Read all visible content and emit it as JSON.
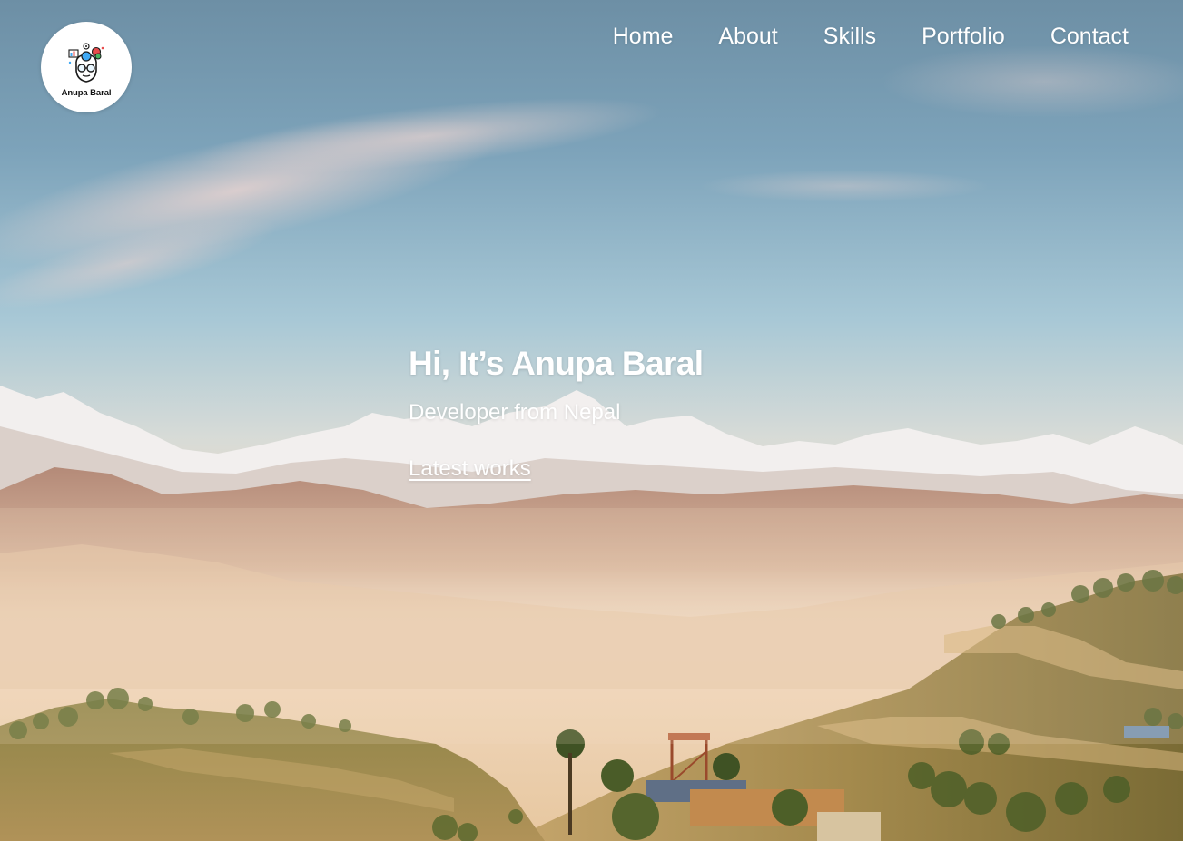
{
  "site": {
    "logo": {
      "text": "Anupa Baral",
      "icon": "avatar-head-icon"
    }
  },
  "nav": {
    "items": [
      {
        "label": "Home"
      },
      {
        "label": "About"
      },
      {
        "label": "Skills"
      },
      {
        "label": "Portfolio"
      },
      {
        "label": "Contact"
      }
    ]
  },
  "hero": {
    "title": "Hi, It’s Anupa Baral",
    "subtitle": "Developer from Nepal",
    "cta_label": "Latest works",
    "background": "himalaya-mountains-landscape-photo"
  },
  "colors": {
    "text": "#ffffff",
    "sky_top": "#6e90a6",
    "sky_mid": "#9fc2d6",
    "haze": "#f1d6bd",
    "hills": "#8a7840",
    "snow": "#f4f1ef"
  }
}
